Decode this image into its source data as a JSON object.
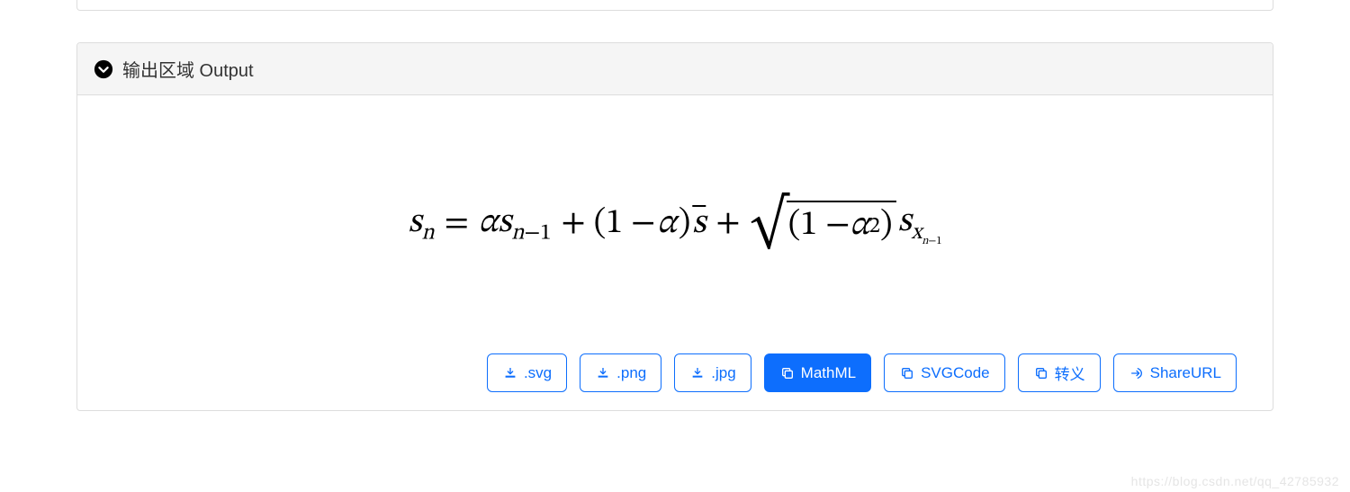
{
  "header": {
    "title": "输出区域 Output"
  },
  "formula": {
    "latex": "s_n = \\alpha s_{n-1} + (1-\\alpha)\\bar{s} + \\sqrt{(1-\\alpha^2)} s_{x_{n-1}}"
  },
  "buttons": {
    "svg": ".svg",
    "png": ".png",
    "jpg": ".jpg",
    "mathml": "MathML",
    "svgcode": "SVGCode",
    "escape": "转义",
    "shareurl": "ShareURL"
  },
  "watermark": "https://blog.csdn.net/qq_42785932"
}
